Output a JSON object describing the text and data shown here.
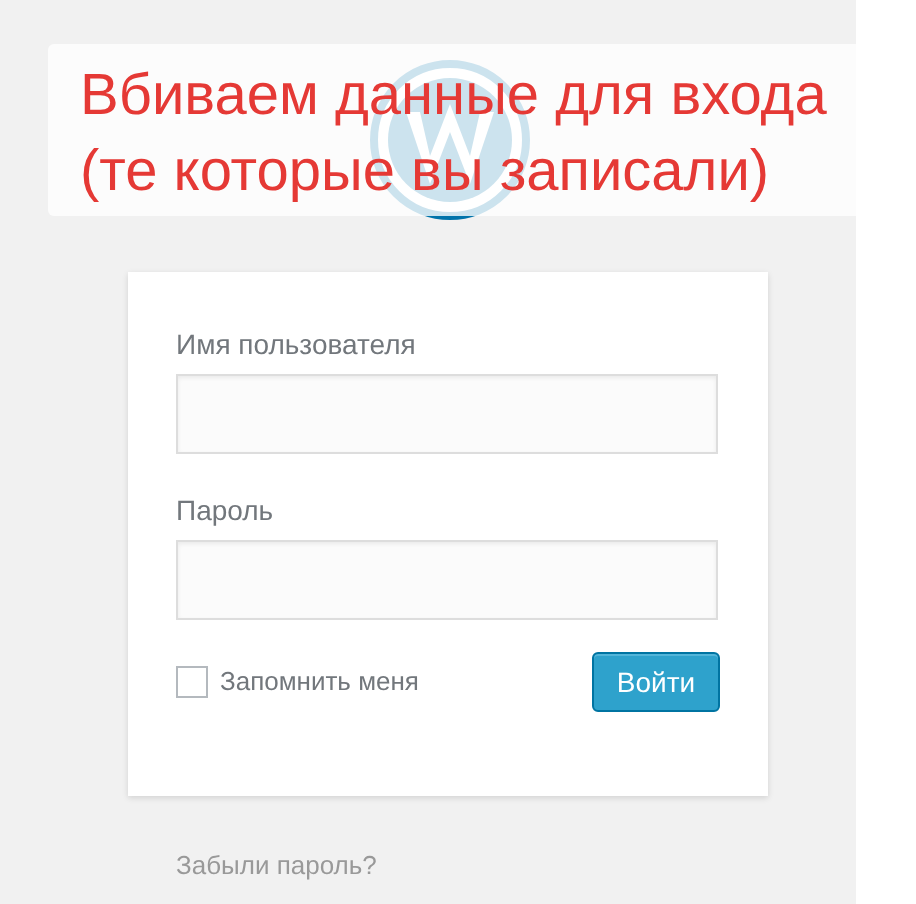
{
  "annotation": {
    "lines": [
      "Вбиваем данные для входа",
      "(те которые вы записали)"
    ]
  },
  "login_form": {
    "fields": [
      {
        "label": "Имя пользователя"
      },
      {
        "label": "Пароль"
      }
    ],
    "remember_me": {
      "label": "Запомнить меня",
      "checked": false
    },
    "submit": "Войти"
  },
  "lost_password_link": "Забыли пароль?"
}
